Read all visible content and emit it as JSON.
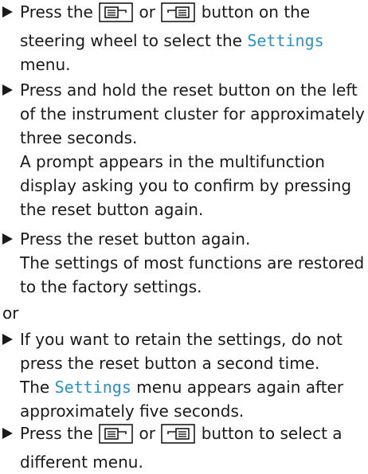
{
  "colors": {
    "text": "#1a1a1a",
    "accent": "#2a92c9"
  },
  "steps": [
    {
      "lines": [
        {
          "before": "Press the",
          "icon1": "menu-back-icon",
          "mid": "or",
          "icon2": "menu-forward-icon",
          "after": "button on the"
        },
        {
          "before": "steering wheel to select the",
          "highlight": "Settings"
        },
        {
          "text": "menu."
        }
      ]
    },
    {
      "lines": [
        {
          "text": "Press and hold the reset button on the left"
        },
        {
          "text": "of the instrument cluster for approximately"
        },
        {
          "text": "three seconds."
        },
        {
          "text": "A prompt appears in the multifunction"
        },
        {
          "text": "display asking you to confirm by pressing"
        },
        {
          "text": "the reset button again."
        }
      ]
    },
    {
      "lines": [
        {
          "text": "Press the reset button again."
        },
        {
          "text": "The settings of most functions are restored"
        },
        {
          "text": "to the factory settings."
        }
      ]
    },
    {
      "lines": [
        {
          "text": "If you want to retain the settings, do not"
        },
        {
          "text": "press the reset button a second time."
        },
        {
          "before": "The",
          "highlight": "Settings",
          "after": "menu appears again after"
        },
        {
          "text": "approximately five seconds."
        }
      ]
    },
    {
      "lines": [
        {
          "before": "Press the",
          "icon1": "menu-back-icon",
          "mid": "or",
          "icon2": "menu-forward-icon",
          "after": "button to select a"
        },
        {
          "text": "different menu."
        }
      ]
    }
  ],
  "separator": "or"
}
